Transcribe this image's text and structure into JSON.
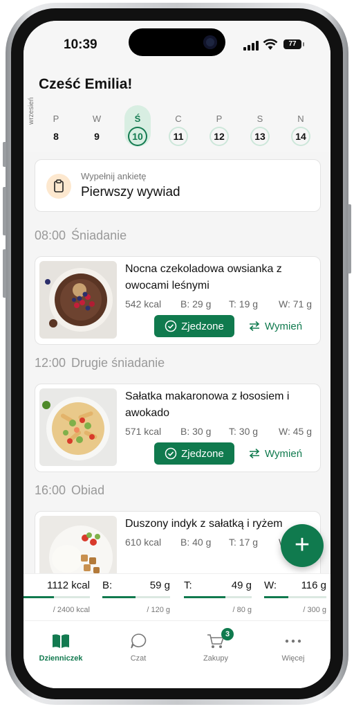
{
  "status": {
    "time": "10:39",
    "battery": "77"
  },
  "greeting": "Cześć Emilia!",
  "week": {
    "month": "wrzesień",
    "days": [
      {
        "letter": "P",
        "num": "8"
      },
      {
        "letter": "W",
        "num": "9"
      },
      {
        "letter": "Ś",
        "num": "10"
      },
      {
        "letter": "C",
        "num": "11"
      },
      {
        "letter": "P",
        "num": "12"
      },
      {
        "letter": "S",
        "num": "13"
      },
      {
        "letter": "N",
        "num": "14"
      }
    ]
  },
  "survey": {
    "subtitle": "Wypełnij ankietę",
    "title": "Pierwszy wywiad",
    "icon": "clipboard-icon"
  },
  "meals": [
    {
      "time": "08:00",
      "label": "Śniadanie",
      "name": "Nocna czekoladowa owsianka z owocami leśnymi",
      "kcal": "542 kcal",
      "b": "B: 29 g",
      "t": "T: 19 g",
      "w": "W: 71 g",
      "eaten": "Zjedzone",
      "swap": "Wymień"
    },
    {
      "time": "12:00",
      "label": "Drugie śniadanie",
      "name": "Sałatka makaronowa z łososiem i awokado",
      "kcal": "571 kcal",
      "b": "B: 30 g",
      "t": "T: 30 g",
      "w": "W: 45 g",
      "eaten": "Zjedzone",
      "swap": "Wymień"
    },
    {
      "time": "16:00",
      "label": "Obiad",
      "name": "Duszony indyk z sałatką i ryżem",
      "kcal": "610 kcal",
      "b": "B: 40 g",
      "t": "T: 17 g",
      "w": "W",
      "eaten": "",
      "swap": ""
    }
  ],
  "summary": [
    {
      "label": "",
      "value": "1112 kcal",
      "target": "/ 2400 kcal",
      "progress": 0.46
    },
    {
      "label": "B:",
      "value": "59 g",
      "target": "/ 120 g",
      "progress": 0.49
    },
    {
      "label": "T:",
      "value": "49 g",
      "target": "/ 80 g",
      "progress": 0.61
    },
    {
      "label": "W:",
      "value": "116 g",
      "target": "/ 300 g",
      "progress": 0.39
    }
  ],
  "tabs": [
    {
      "label": "Dzienniczek",
      "icon": "book-icon"
    },
    {
      "label": "Czat",
      "icon": "chat-icon"
    },
    {
      "label": "Zakupy",
      "icon": "cart-icon",
      "badge": "3"
    },
    {
      "label": "Więcej",
      "icon": "more-icon"
    }
  ],
  "colors": {
    "accent": "#107a4e",
    "accent_light": "#d8eee2"
  }
}
